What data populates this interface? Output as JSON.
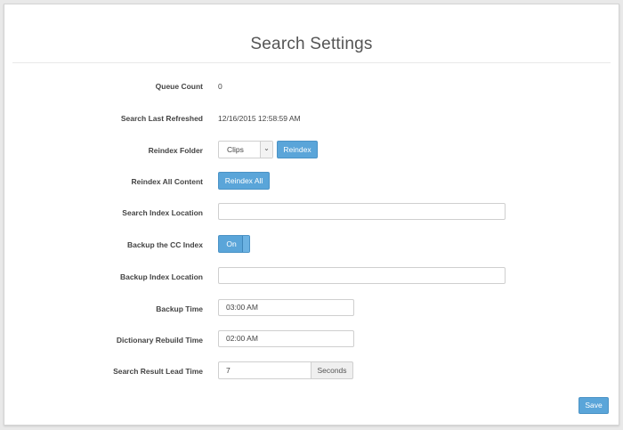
{
  "page": {
    "title": "Search Settings"
  },
  "fields": {
    "queue_count": {
      "label": "Queue Count",
      "value": "0"
    },
    "last_refreshed": {
      "label": "Search Last Refreshed",
      "value": "12/16/2015 12:58:59 AM"
    },
    "reindex_folder": {
      "label": "Reindex Folder",
      "selected": "Clips",
      "button": "Reindex"
    },
    "reindex_all": {
      "label": "Reindex All Content",
      "button": "Reindex All"
    },
    "search_index_location": {
      "label": "Search Index Location",
      "value": ""
    },
    "backup_cc_index": {
      "label": "Backup the CC Index",
      "toggle": "On"
    },
    "backup_index_location": {
      "label": "Backup Index Location",
      "value": ""
    },
    "backup_time": {
      "label": "Backup Time",
      "value": "03:00 AM"
    },
    "dictionary_rebuild_time": {
      "label": "Dictionary Rebuild Time",
      "value": "02:00 AM"
    },
    "search_result_lead_time": {
      "label": "Search Result Lead Time",
      "value": "7",
      "unit": "Seconds"
    }
  },
  "actions": {
    "save": "Save"
  },
  "colors": {
    "accent": "#5aa5d9",
    "background": "#e9e9e9",
    "panel": "#ffffff"
  }
}
